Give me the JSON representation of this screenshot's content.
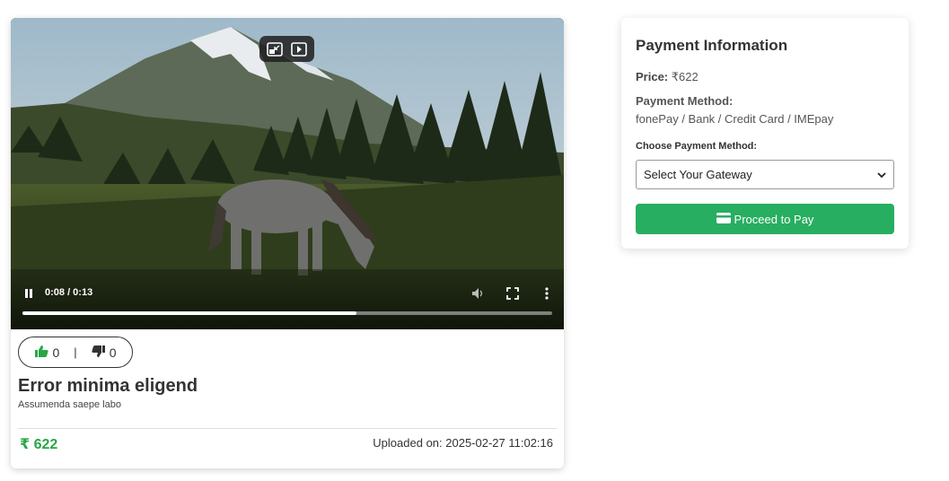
{
  "video": {
    "time_display": "0:08 / 0:13",
    "progress_fraction": 0.63,
    "likes": "0",
    "dislikes": "0",
    "separator": "|",
    "title": "Error minima eligend",
    "description": "Assumenda saepe labo",
    "price": "₹ 622",
    "uploaded": "Uploaded on: 2025-02-27 11:02:16",
    "icons": {
      "pip": "picture-in-picture-icon",
      "cast": "play-in-window-icon",
      "play_state": "pause-icon",
      "volume": "volume-icon",
      "fullscreen": "fullscreen-icon",
      "more": "more-vertical-icon",
      "like": "thumbs-up-icon",
      "dislike": "thumbs-down-icon"
    }
  },
  "payment": {
    "title": "Payment Information",
    "price_label": "Price:",
    "price_value": " ₹622",
    "method_label": "Payment Method:",
    "method_value": "fonePay / Bank / Credit Card / IMEpay",
    "choose_label": "Choose Payment Method:",
    "gateway_selected": "Select Your Gateway",
    "button_label": "Proceed to Pay",
    "button_icon": "credit-card-icon"
  },
  "colors": {
    "accent_green": "#27ae60",
    "price_green": "#28a745"
  }
}
